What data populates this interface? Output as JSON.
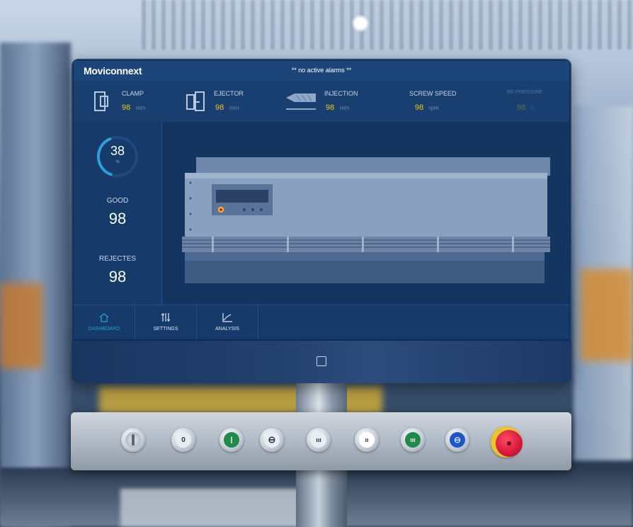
{
  "header": {
    "logo": "Moviconnext",
    "alarm_text": "** no active alarms **"
  },
  "parameters": [
    {
      "label": "CLAMP",
      "value": "98",
      "unit": "mm",
      "icon": "clamp-icon"
    },
    {
      "label": "EJECTOR",
      "value": "98",
      "unit": "mm",
      "icon": "ejector-icon"
    },
    {
      "label": "INJECTION",
      "value": "98",
      "unit": "mm",
      "icon": "injection-icon"
    },
    {
      "label": "SCREW SPEED",
      "value": "98",
      "unit": "rpm"
    },
    {
      "label": "RE-PRESSURE",
      "value": "98",
      "unit": "b"
    }
  ],
  "sidebar": {
    "gauge": {
      "value": "38",
      "unit": "%",
      "fraction": 0.38
    },
    "good": {
      "label": "GOOD",
      "value": "98"
    },
    "rejects": {
      "label": "REJECTES",
      "value": "98"
    }
  },
  "nav": [
    {
      "label": "DASHBOARD",
      "icon": "home-icon",
      "active": true
    },
    {
      "label": "SETTINGS",
      "icon": "sliders-icon",
      "active": false
    },
    {
      "label": "ANALYSIS",
      "icon": "chart-icon",
      "active": false
    }
  ],
  "panel_buttons": [
    {
      "icon": "key-switch-icon",
      "glyph": ""
    },
    {
      "icon": "off-button-icon",
      "glyph": "0"
    },
    {
      "icon": "on-button-icon",
      "glyph": "|"
    },
    {
      "icon": "clock-button-icon",
      "glyph": "⊖"
    },
    {
      "icon": "mode-button-icon",
      "glyph": "ııı"
    },
    {
      "icon": "white-mode-button-icon",
      "glyph": "ıı"
    },
    {
      "icon": "green-mode-button-icon",
      "glyph": "ııı"
    },
    {
      "icon": "blue-button-icon",
      "glyph": "⊖"
    }
  ],
  "colors": {
    "accent": "#2a9fd8",
    "value": "#f0c419",
    "estop": "#d8173a",
    "estop_ring": "#e9c52a",
    "green_button": "#1f8a4a",
    "blue_button": "#1f55c9"
  }
}
